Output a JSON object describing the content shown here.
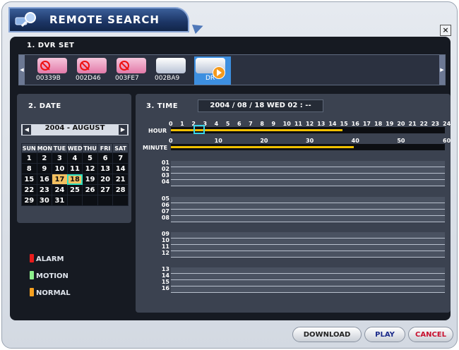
{
  "window": {
    "title": "REMOTE SEARCH",
    "close_label": "×"
  },
  "dvr_set": {
    "title": "1. DVR SET",
    "devices": [
      {
        "label": "00339B",
        "icon": "dvr-pink-disabled-icon"
      },
      {
        "label": "002D46",
        "icon": "dvr-pink-disabled-icon"
      },
      {
        "label": "003FE7",
        "icon": "dvr-pink-disabled-icon"
      },
      {
        "label": "002BA9",
        "icon": "dvr-white-icon"
      },
      {
        "label": "DR",
        "icon": "dvr-white-play-icon",
        "selected": true
      }
    ]
  },
  "date": {
    "title": "2. DATE",
    "month_label": "2004 - AUGUST",
    "weekdays": [
      "SUN",
      "MON",
      "TUE",
      "WED",
      "THU",
      "FRI",
      "SAT"
    ],
    "weeks": [
      [
        "1",
        "2",
        "3",
        "4",
        "5",
        "6",
        "7"
      ],
      [
        "8",
        "9",
        "10",
        "11",
        "12",
        "13",
        "14"
      ],
      [
        "15",
        "16",
        "17",
        "18",
        "19",
        "20",
        "21"
      ],
      [
        "22",
        "23",
        "24",
        "25",
        "26",
        "27",
        "28"
      ],
      [
        "29",
        "30",
        "31",
        "",
        "",
        "",
        ""
      ]
    ],
    "recorded_days": [
      "17",
      "18"
    ],
    "selected_day": "18"
  },
  "legend": [
    {
      "label": "ALARM",
      "color": "#e81c1c"
    },
    {
      "label": "MOTION",
      "color": "#8cf08c"
    },
    {
      "label": "NORMAL",
      "color": "#f5a020"
    }
  ],
  "time": {
    "title": "3. TIME",
    "datetime": "2004 / 08 / 18 WED 02 : --",
    "hour_label": "HOUR",
    "minute_label": "MINUTE",
    "hour_ticks": [
      "0",
      "1",
      "2",
      "3",
      "4",
      "5",
      "6",
      "7",
      "8",
      "9",
      "10",
      "11",
      "12",
      "13",
      "14",
      "15",
      "16",
      "17",
      "18",
      "19",
      "20",
      "21",
      "22",
      "23",
      "24"
    ],
    "minute_ticks": [
      "0",
      "10",
      "20",
      "30",
      "40",
      "50",
      "60"
    ],
    "hour_recorded_until": 15,
    "selected_hour": 2,
    "minute_recorded_until": 40,
    "channel_groups": [
      [
        "01",
        "02",
        "03",
        "04"
      ],
      [
        "05",
        "06",
        "07",
        "08"
      ],
      [
        "09",
        "10",
        "11",
        "12"
      ],
      [
        "13",
        "14",
        "15",
        "16"
      ]
    ]
  },
  "buttons": {
    "download": "DOWNLOAD",
    "play": "PLAY",
    "cancel": "CANCEL"
  },
  "colors": {
    "record": "#f0c000",
    "selected_outline": "#39d4e8",
    "cancel_text": "#c8102e",
    "play_text": "#1a2a8a"
  }
}
